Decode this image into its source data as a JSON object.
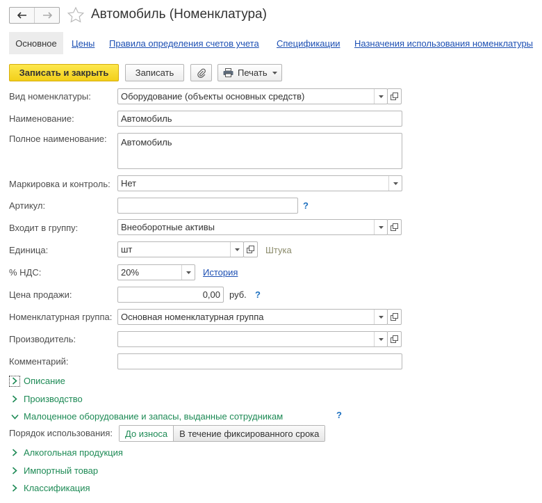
{
  "window": {
    "title": "Автомобиль (Номенклатура)"
  },
  "tabs": [
    {
      "label": "Основное",
      "active": true
    },
    {
      "label": "Цены"
    },
    {
      "label": "Правила определения счетов учета"
    },
    {
      "label": "Спецификации"
    },
    {
      "label": "Назначения использования номенклатуры"
    }
  ],
  "toolbar": {
    "save_close": "Записать и закрыть",
    "save": "Записать",
    "print": "Печать"
  },
  "form": {
    "kind": {
      "label": "Вид номенклатуры:",
      "value": "Оборудование (объекты основных средств)"
    },
    "name": {
      "label": "Наименование:",
      "value": "Автомобиль"
    },
    "full_name": {
      "label": "Полное наименование:",
      "value": "Автомобиль"
    },
    "marking": {
      "label": "Маркировка и контроль:",
      "value": "Нет"
    },
    "article": {
      "label": "Артикул:",
      "value": "",
      "hint": "?"
    },
    "group": {
      "label": "Входит в группу:",
      "value": "Внеоборотные активы"
    },
    "unit": {
      "label": "Единица:",
      "value": "шт",
      "note": "Штука"
    },
    "vat": {
      "label": "% НДС:",
      "value": "20%",
      "history_link": "История"
    },
    "price": {
      "label": "Цена продажи:",
      "value": "0,00",
      "currency": "руб.",
      "hint": "?"
    },
    "nom_group": {
      "label": "Номенклатурная группа:",
      "value": "Основная номенклатурная группа"
    },
    "manufacturer": {
      "label": "Производитель:",
      "value": ""
    },
    "comment": {
      "label": "Комментарий:",
      "value": ""
    }
  },
  "groups": {
    "description": "Описание",
    "production": "Производство",
    "low_value": "Малоценное оборудование и запасы, выданные сотрудникам",
    "low_value_hint": "?",
    "usage_label": "Порядок использования:",
    "usage_options": [
      "До износа",
      "В течение фиксированного срока"
    ],
    "alcohol": "Алкогольная продукция",
    "import": "Импортный товар",
    "classification": "Классификация"
  },
  "colors": {
    "primary_button": "#f2cf1a",
    "link": "#1c4fb3",
    "group_title": "#1d8a55"
  },
  "icons": [
    "back-arrow-icon",
    "forward-arrow-icon",
    "star-icon",
    "paperclip-icon",
    "printer-icon",
    "chevron-down-icon",
    "open-window-icon",
    "chevron-right-icon"
  ]
}
